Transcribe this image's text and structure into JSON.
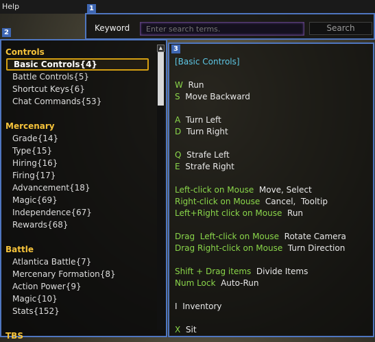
{
  "window_title": "Help",
  "section_numbers": [
    "1",
    "2",
    "3"
  ],
  "search": {
    "label": "Keyword",
    "placeholder": "Enter search terms.",
    "button": "Search"
  },
  "categories": [
    {
      "title": "Controls",
      "items": [
        {
          "label": "Basic Controls{4}",
          "selected": true
        },
        {
          "label": "Battle Controls{5}"
        },
        {
          "label": "Shortcut Keys{6}"
        },
        {
          "label": "Chat Commands{53}"
        }
      ]
    },
    {
      "title": "Mercenary",
      "items": [
        {
          "label": "Grade{14}"
        },
        {
          "label": "Type{15}"
        },
        {
          "label": "Hiring{16}"
        },
        {
          "label": "Firing{17}"
        },
        {
          "label": "Advancement{18}"
        },
        {
          "label": "Magic{69}"
        },
        {
          "label": "Independence{67}"
        },
        {
          "label": "Rewards{68}"
        }
      ]
    },
    {
      "title": "Battle",
      "items": [
        {
          "label": "Atlantica Battle{7}"
        },
        {
          "label": "Mercenary Formation{8}"
        },
        {
          "label": "Action Power{9}"
        },
        {
          "label": "Magic{10}"
        },
        {
          "label": "Stats{152}"
        }
      ]
    },
    {
      "title": "TBS",
      "items": []
    }
  ],
  "content": {
    "title": "[Basic Controls]",
    "blocks": [
      [
        {
          "key": "W",
          "desc": "Run"
        },
        {
          "key": "S",
          "desc": "Move Backward"
        }
      ],
      [
        {
          "key": "A",
          "desc": "Turn Left"
        },
        {
          "key": "D",
          "desc": "Turn Right"
        }
      ],
      [
        {
          "key": "Q",
          "desc": "Strafe Left"
        },
        {
          "key": "E",
          "desc": "Strafe Right"
        }
      ],
      [
        {
          "key": "Left-click on Mouse",
          "desc": "Move, Select"
        },
        {
          "key": "Right-click on Mouse",
          "desc": "Cancel,  Tooltip"
        },
        {
          "key": "Left+Right click on Mouse",
          "desc": "Run"
        }
      ],
      [
        {
          "key": "Drag  Left-click on Mouse",
          "desc": "Rotate Camera"
        },
        {
          "key": "Drag Right-click on Mouse",
          "desc": "Turn Direction"
        }
      ],
      [
        {
          "key": "Shift + Drag items",
          "desc": "Divide Items"
        },
        {
          "key": "Num Lock",
          "desc": "Auto-Run"
        }
      ],
      [
        {
          "key": "I",
          "desc": "Inventory",
          "key_color": "white"
        }
      ],
      [
        {
          "key": "X",
          "desc": "Sit"
        }
      ]
    ]
  },
  "colors": {
    "panel_border": "#4f76c0",
    "category": "#f6c33a",
    "key_text": "#8ad64a",
    "title_text": "#5ec8e6",
    "selection_border": "#d5a012"
  },
  "scrollbar": {
    "up_arrow": "triangle-up-icon"
  }
}
